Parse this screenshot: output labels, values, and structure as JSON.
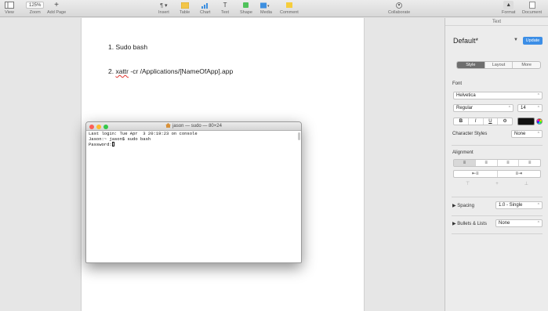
{
  "toolbar": {
    "view": {
      "label": "View"
    },
    "zoom": {
      "value": "125%",
      "label": "Zoom"
    },
    "add_page": {
      "label": "Add Page"
    },
    "insert": {
      "label": "Insert"
    },
    "table": {
      "label": "Table"
    },
    "chart": {
      "label": "Chart"
    },
    "text": {
      "label": "Text"
    },
    "shape": {
      "label": "Shape"
    },
    "media": {
      "label": "Media"
    },
    "comment": {
      "label": "Comment"
    },
    "collaborate": {
      "label": "Collaborate"
    },
    "format": {
      "label": "Format"
    },
    "document": {
      "label": "Document"
    }
  },
  "document": {
    "lines": [
      {
        "number": "1.",
        "text": "Sudo bash"
      },
      {
        "number": "2.",
        "word1": "xattr",
        "rest": " -cr /Applications/[NameOfApp].app"
      }
    ]
  },
  "terminal": {
    "title": "jason — sudo — 80×24",
    "line1": "Last login: Tue Apr  3 20:19:23 on console",
    "line2": "Jason:~ jason$ sudo bash",
    "line3": "Password:"
  },
  "inspector": {
    "header": "Text",
    "style_name": "Default*",
    "update_label": "Update",
    "tabs": [
      "Style",
      "Layout",
      "More"
    ],
    "active_tab": "Style",
    "font_label": "Font",
    "font_family": "Helvetica",
    "font_weight": "Regular",
    "font_size": "14",
    "format_buttons": [
      "B",
      "I",
      "U",
      "⚙"
    ],
    "text_color": "#111111",
    "char_styles_label": "Character Styles",
    "char_styles_value": "None",
    "alignment_label": "Alignment",
    "spacing_label": "Spacing",
    "spacing_value": "1.0 - Single",
    "bullets_label": "Bullets & Lists",
    "bullets_value": "None"
  },
  "colors": {
    "accent": "#3c8ee6",
    "traffic_red": "#fc5f57",
    "traffic_yellow": "#fdbc2e",
    "traffic_green": "#34c84a"
  }
}
